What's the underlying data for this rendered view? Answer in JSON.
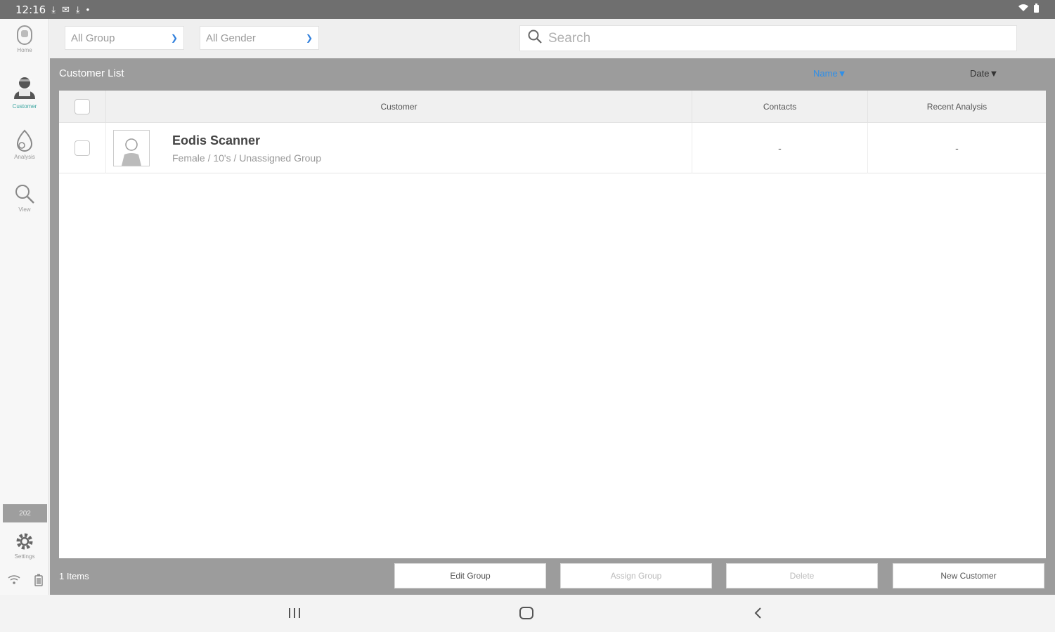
{
  "status_bar": {
    "time": "12:16",
    "icons": [
      "download-icon",
      "mail-icon",
      "download-icon",
      "dot-icon"
    ],
    "right_icons": [
      "wifi-icon",
      "battery-icon"
    ]
  },
  "sidebar": {
    "items": [
      {
        "label": "Home",
        "icon": "home-icon"
      },
      {
        "label": "Customer",
        "icon": "customer-icon",
        "active": true
      },
      {
        "label": "Analysis",
        "icon": "analysis-icon"
      },
      {
        "label": "View",
        "icon": "search-icon"
      }
    ],
    "version": "202",
    "settings_label": "Settings"
  },
  "filters": {
    "group": "All Group",
    "gender": "All Gender",
    "search_placeholder": "Search"
  },
  "list": {
    "title": "Customer List",
    "sort_name": "Name▼",
    "sort_date": "Date▼",
    "columns": [
      "Customer",
      "Contacts",
      "Recent Analysis"
    ],
    "rows": [
      {
        "name": "Eodis Scanner",
        "detail": "Female / 10's / Unassigned Group",
        "contacts": "-",
        "recent_analysis": "-"
      }
    ],
    "count": "1 Items"
  },
  "footer_buttons": {
    "edit_group": "Edit Group",
    "assign_group": "Assign Group",
    "delete": "Delete",
    "new_customer": "New Customer"
  },
  "colors": {
    "accent_blue": "#2f8fe8",
    "active_teal": "#3aa5a0",
    "header_gray": "#9c9c9c"
  }
}
